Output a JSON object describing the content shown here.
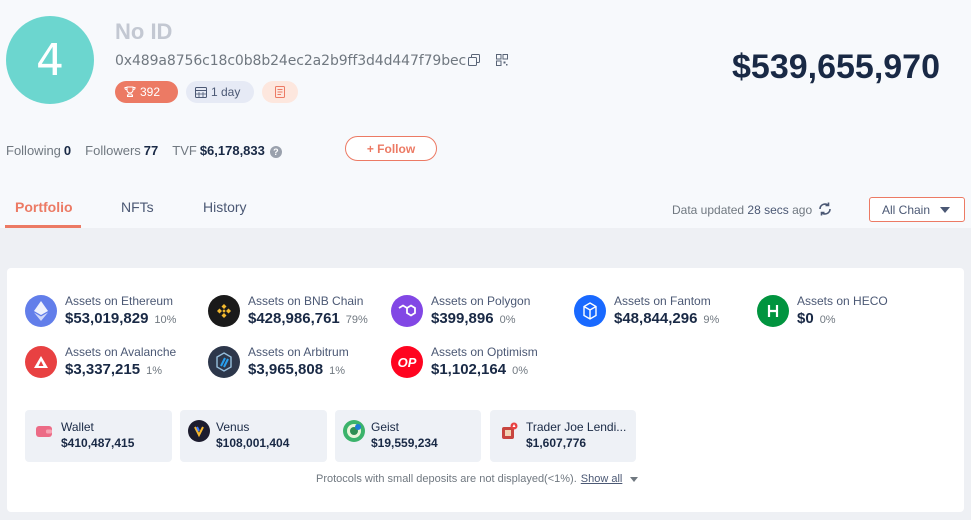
{
  "profile": {
    "avatar_text": "4",
    "name": "No ID",
    "address": "0x489a8756c18c0b8b24ec2a2b9ff3d4d447f79bec",
    "rank": "392",
    "period": "1 day",
    "total_value": "$539,655,970"
  },
  "social": {
    "following_label": "Following",
    "following_count": "0",
    "followers_label": "Followers",
    "followers_count": "77",
    "tvf_label": "TVF",
    "tvf_value": "$6,178,833",
    "follow_button": "+ Follow"
  },
  "tabs": [
    {
      "label": "Portfolio",
      "active": true
    },
    {
      "label": "NFTs",
      "active": false
    },
    {
      "label": "History",
      "active": false
    }
  ],
  "status": {
    "updated_prefix": "Data updated",
    "updated_time": "28 secs",
    "updated_suffix": "ago",
    "chain_filter": "All Chain"
  },
  "chains": [
    {
      "label": "Assets on Ethereum",
      "value": "$53,019,829",
      "pct": "10%",
      "icon": "ethereum-icon",
      "color": "#627eea"
    },
    {
      "label": "Assets on BNB Chain",
      "value": "$428,986,761",
      "pct": "79%",
      "icon": "bnb-icon",
      "color": "#1a1a1a"
    },
    {
      "label": "Assets on Polygon",
      "value": "$399,896",
      "pct": "0%",
      "icon": "polygon-icon",
      "color": "#8247e5"
    },
    {
      "label": "Assets on Fantom",
      "value": "$48,844,296",
      "pct": "9%",
      "icon": "fantom-icon",
      "color": "#1969ff"
    },
    {
      "label": "Assets on HECO",
      "value": "$0",
      "pct": "0%",
      "icon": "heco-icon",
      "color": "#01943f"
    },
    {
      "label": "Assets on Avalanche",
      "value": "$3,337,215",
      "pct": "1%",
      "icon": "avalanche-icon",
      "color": "#e84142"
    },
    {
      "label": "Assets on Arbitrum",
      "value": "$3,965,808",
      "pct": "1%",
      "icon": "arbitrum-icon",
      "color": "#2d374b"
    },
    {
      "label": "Assets on Optimism",
      "value": "$1,102,164",
      "pct": "0%",
      "icon": "optimism-icon",
      "color": "#ff0420",
      "icon_text": "OP"
    }
  ],
  "protocols": [
    {
      "name": "Wallet",
      "value": "$410,487,415",
      "icon": "wallet-icon",
      "color": "#ec6b86"
    },
    {
      "name": "Venus",
      "value": "$108,001,404",
      "icon": "venus-icon",
      "color": "#1c1c2e"
    },
    {
      "name": "Geist",
      "value": "$19,559,234",
      "icon": "geist-icon",
      "color": "#3bb36b"
    },
    {
      "name": "Trader Joe Lendi...",
      "value": "$1,607,776",
      "icon": "traderjoe-icon",
      "color": "#c8453f"
    }
  ],
  "footer": {
    "note": "Protocols with small deposits are not displayed(<1%).",
    "show_all": "Show all"
  }
}
